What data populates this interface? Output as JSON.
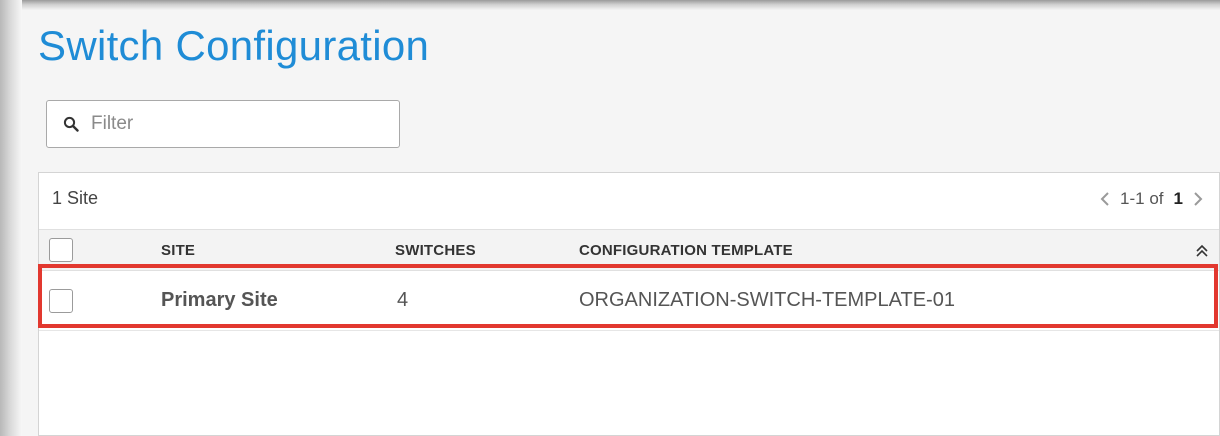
{
  "page": {
    "title": "Switch Configuration"
  },
  "filter": {
    "placeholder": "Filter",
    "value": ""
  },
  "table": {
    "count_label": "1 Site",
    "pagination": {
      "range": "1-1 of",
      "total": "1"
    },
    "columns": [
      "SITE",
      "SWITCHES",
      "CONFIGURATION TEMPLATE"
    ],
    "rows": [
      {
        "site": "Primary Site",
        "switches": "4",
        "template": "ORGANIZATION-SWITCH-TEMPLATE-01"
      }
    ]
  },
  "colors": {
    "title": "#1f8cd6",
    "highlight": "#e2382f"
  },
  "icons": {
    "search": "search-icon",
    "prev": "chevron-left-icon",
    "next": "chevron-right-icon",
    "collapse": "double-chevron-up-icon"
  }
}
